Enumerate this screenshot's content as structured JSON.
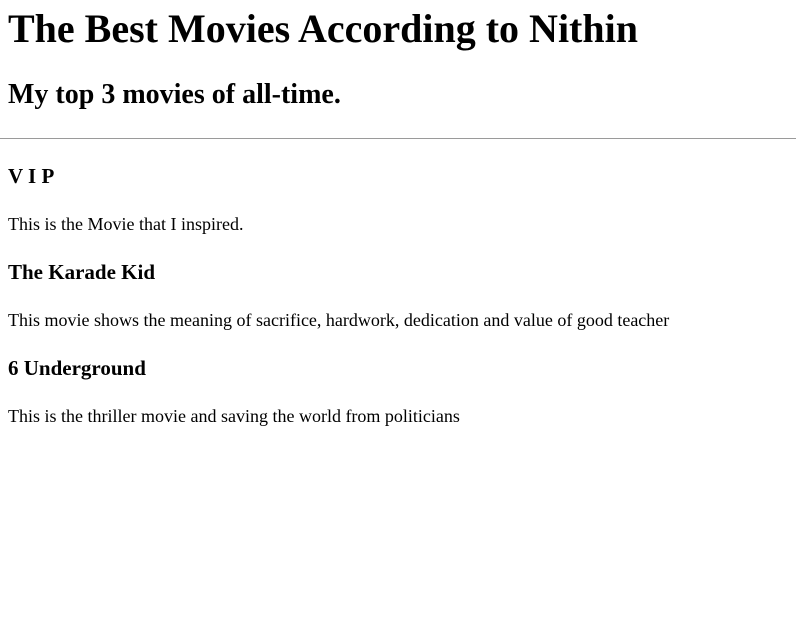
{
  "page": {
    "title": "The Best Movies According to Nithin",
    "subtitle": "My top 3 movies of all-time."
  },
  "movies": [
    {
      "title": "V I P",
      "description": "This is the Movie that I inspired."
    },
    {
      "title": "The Karade Kid",
      "description": "This movie shows the meaning of sacrifice, hardwork, dedication and value of good teacher"
    },
    {
      "title": "6 Underground",
      "description": "This is the thriller movie and saving the world from politicians"
    }
  ]
}
